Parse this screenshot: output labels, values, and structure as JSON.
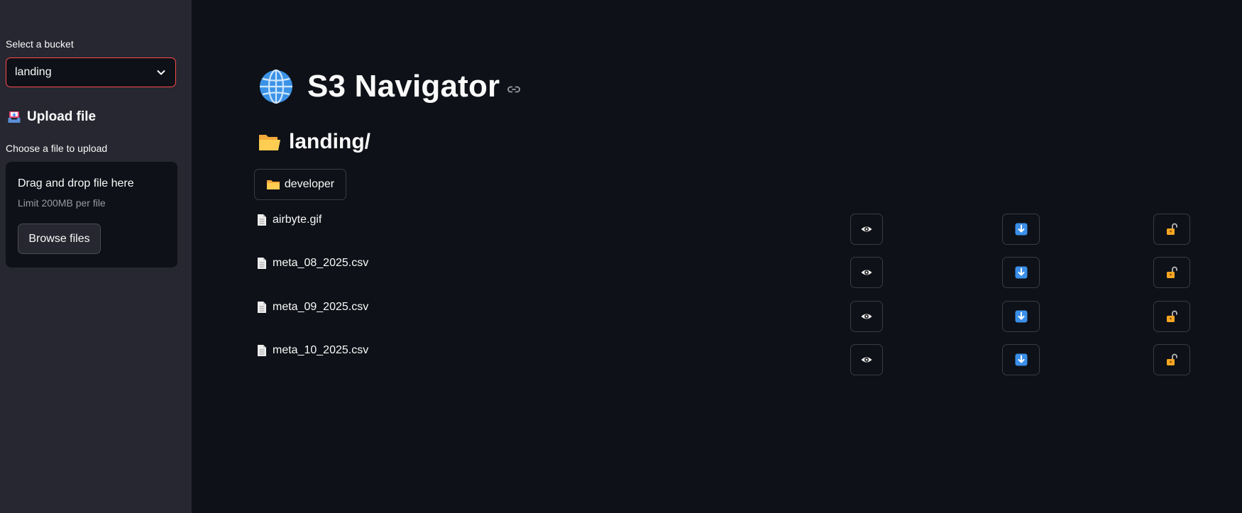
{
  "sidebar": {
    "bucket_label": "Select a bucket",
    "bucket_selected": "landing",
    "upload_heading": "Upload file",
    "upload_heading_icon": "inbox-tray-icon",
    "choose_label": "Choose a file to upload",
    "dropzone": {
      "title": "Drag and drop file here",
      "limit": "Limit 200MB per file",
      "browse_label": "Browse files"
    }
  },
  "main": {
    "title": "S3 Navigator",
    "title_icon": "globe-icon",
    "path_heading": "landing/",
    "folders": [
      {
        "label": "developer"
      }
    ],
    "files": [
      {
        "name": "airbyte.gif"
      },
      {
        "name": "meta_08_2025.csv"
      },
      {
        "name": "meta_09_2025.csv"
      },
      {
        "name": "meta_10_2025.csv"
      }
    ],
    "row_actions": [
      "eye-icon",
      "download-arrow-icon",
      "unlock-icon"
    ]
  },
  "colors": {
    "background": "#0e1117",
    "sidebar": "#262730",
    "accent_border": "#ff4b4b",
    "text": "#fafafa"
  }
}
